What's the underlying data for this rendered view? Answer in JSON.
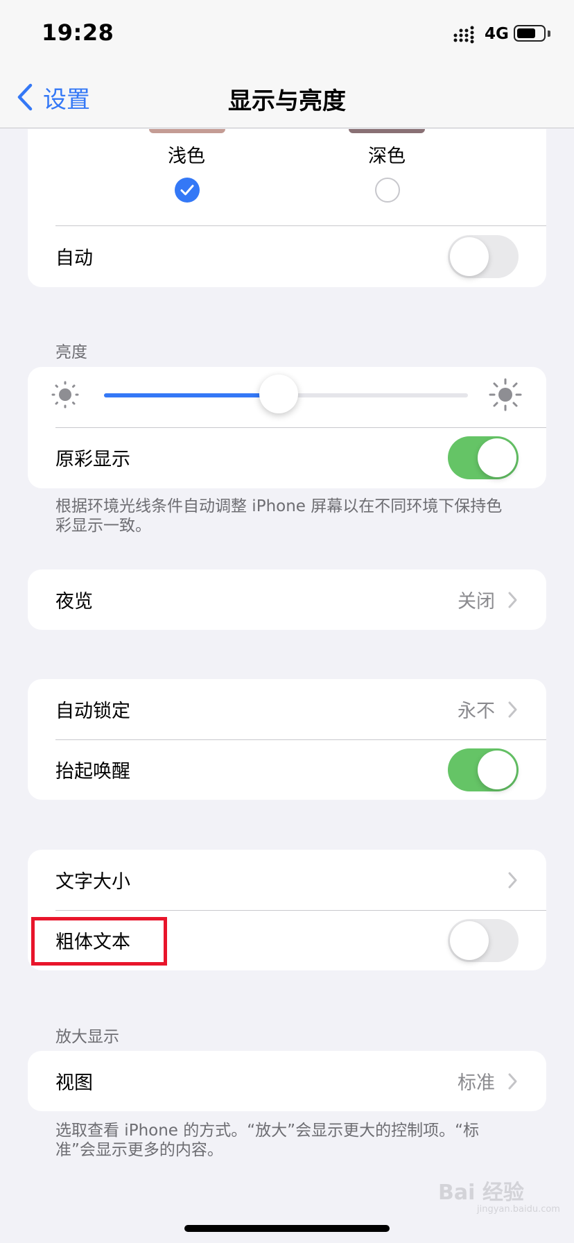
{
  "status_bar": {
    "time": "19:28",
    "network": "4G",
    "battery_level": 0.72
  },
  "nav": {
    "back_label": "设置",
    "title": "显示与亮度"
  },
  "appearance": {
    "light_label": "浅色",
    "dark_label": "深色",
    "selected": "light",
    "auto_label": "自动",
    "auto_on": false
  },
  "brightness": {
    "header": "亮度",
    "level": 0.48,
    "true_tone_label": "原彩显示",
    "true_tone_on": true,
    "footer": "根据环境光线条件自动调整 iPhone 屏幕以在不同环境下保持色彩显示一致。"
  },
  "night_shift": {
    "label": "夜览",
    "value": "关闭"
  },
  "lock": {
    "auto_lock_label": "自动锁定",
    "auto_lock_value": "永不",
    "raise_to_wake_label": "抬起唤醒",
    "raise_to_wake_on": true
  },
  "text": {
    "text_size_label": "文字大小",
    "bold_text_label": "粗体文本",
    "bold_text_on": false
  },
  "zoom": {
    "header": "放大显示",
    "view_label": "视图",
    "view_value": "标准",
    "footer": "选取查看 iPhone 的方式。“放大”会显示更大的控制项。“标准”会显示更多的内容。"
  },
  "watermark": {
    "main": "Bai 经验",
    "sub": "jingyan.baidu.com"
  },
  "colors": {
    "accent": "#3478f6",
    "toggle_on": "#65c466",
    "highlight": "#e8152b"
  }
}
